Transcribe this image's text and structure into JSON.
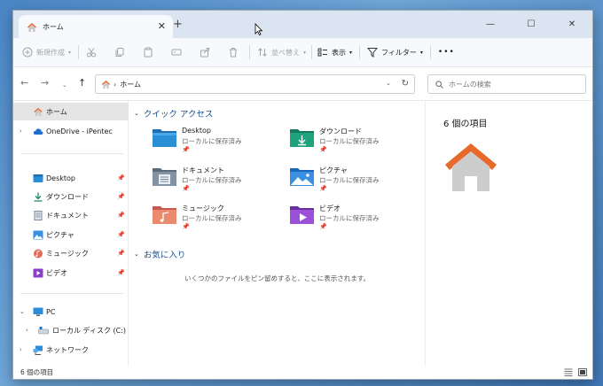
{
  "tab": {
    "title": "ホーム",
    "close": "✕",
    "new_tab": "+"
  },
  "window_controls": {
    "minimize": "—",
    "maximize": "☐",
    "close": "✕"
  },
  "commands": {
    "new": "新規作成",
    "sort": "並べ替え",
    "view": "表示",
    "filter": "フィルター",
    "more": "•••"
  },
  "address": {
    "text": "ホーム",
    "search_placeholder": "ホームの検索"
  },
  "sidebar": {
    "home": "ホーム",
    "onedrive": "OneDrive - iPentec",
    "quick": [
      "Desktop",
      "ダウンロード",
      "ドキュメント",
      "ピクチャ",
      "ミュージック",
      "ビデオ"
    ],
    "pc": "PC",
    "local_disk": "ローカル ディスク (C:)",
    "network": "ネットワーク"
  },
  "main": {
    "quick_access_title": "クイック アクセス",
    "favorites_title": "お気に入り",
    "favorites_empty": "いくつかのファイルをピン留めすると、ここに表示されます。",
    "items": [
      {
        "name": "Desktop",
        "sub": "ローカルに保存済み",
        "icon": "desktop-folder"
      },
      {
        "name": "ダウンロード",
        "sub": "ローカルに保存済み",
        "icon": "downloads-folder"
      },
      {
        "name": "ドキュメント",
        "sub": "ローカルに保存済み",
        "icon": "documents-folder"
      },
      {
        "name": "ピクチャ",
        "sub": "ローカルに保存済み",
        "icon": "pictures-folder"
      },
      {
        "name": "ミュージック",
        "sub": "ローカルに保存済み",
        "icon": "music-folder"
      },
      {
        "name": "ビデオ",
        "sub": "ローカルに保存済み",
        "icon": "videos-folder"
      }
    ]
  },
  "detail": {
    "count": "6 個の項目"
  },
  "status": {
    "count": "6 個の項目"
  },
  "colors": {
    "accent": "#1c4f8a",
    "home_roof": "#e8692a",
    "titlebar": "#dbe5f1"
  }
}
